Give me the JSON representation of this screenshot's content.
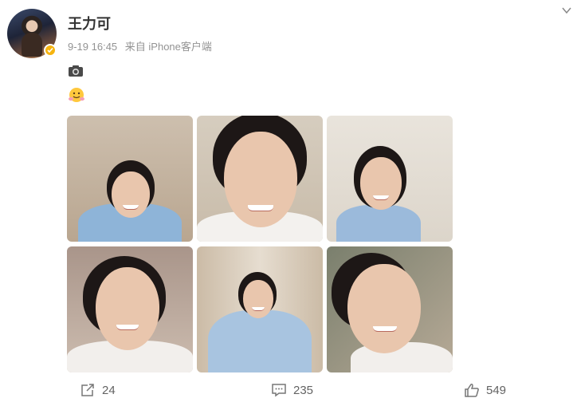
{
  "post": {
    "author": "王力可",
    "time": "9-19 16:45",
    "source": "来自 iPhone客户端",
    "content_icons": [
      "camera-icon",
      "hug-emoji-icon"
    ]
  },
  "photos": [
    {
      "name": "photo-1",
      "desc": "portrait"
    },
    {
      "name": "photo-2",
      "desc": "portrait"
    },
    {
      "name": "photo-3",
      "desc": "portrait"
    },
    {
      "name": "photo-4",
      "desc": "portrait"
    },
    {
      "name": "photo-5",
      "desc": "portrait"
    },
    {
      "name": "photo-6",
      "desc": "portrait"
    }
  ],
  "actions": {
    "repost_count": "24",
    "comment_count": "235",
    "like_count": "549"
  },
  "colors": {
    "verify_badge": "#f6b40f",
    "meta_text": "#939393",
    "action_text": "#636363"
  }
}
